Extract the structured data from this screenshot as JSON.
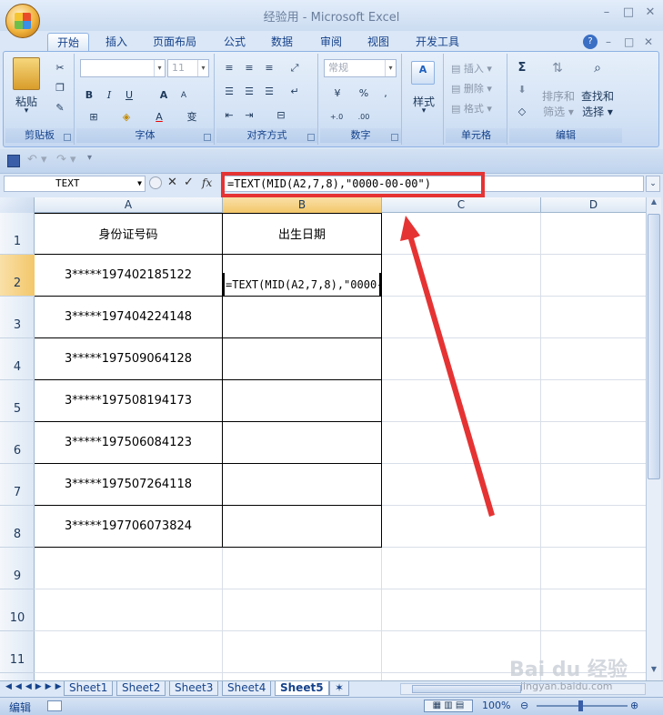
{
  "window": {
    "title": "经验用 - Microsoft Excel",
    "controls": {
      "minimize": "–",
      "maximize": "□",
      "close": "✕"
    }
  },
  "ribbon_tabs": [
    "开始",
    "插入",
    "页面布局",
    "公式",
    "数据",
    "审阅",
    "视图",
    "开发工具"
  ],
  "active_tab": "开始",
  "ribbon": {
    "clipboard": {
      "label": "剪贴板",
      "paste": "粘贴"
    },
    "font": {
      "label": "字体",
      "size": "11",
      "bold": "B",
      "italic": "I",
      "underline": "U"
    },
    "alignment": {
      "label": "对齐方式"
    },
    "number": {
      "label": "数字",
      "format": "常规",
      "percent": "%",
      "comma": ",",
      "inc_decimal": "+.0",
      "dec_decimal": ".00"
    },
    "styles": {
      "label": "样式"
    },
    "cells": {
      "label": "单元格",
      "insert": "插入",
      "delete": "删除",
      "format": "格式"
    },
    "editing": {
      "label": "编辑",
      "sort_filter_1": "排序和",
      "sort_filter_2": "筛选",
      "find_select_1": "查找和",
      "find_select_2": "选择"
    }
  },
  "formula_bar": {
    "name_box": "TEXT",
    "fx": "fx",
    "formula": "=TEXT(MID(A2,7,8),\"0000-00-00\")"
  },
  "columns": [
    "A",
    "B",
    "C",
    "D"
  ],
  "rows": [
    "1",
    "2",
    "3",
    "4",
    "5",
    "6",
    "7",
    "8",
    "9",
    "10",
    "11"
  ],
  "cells": {
    "A1": "身份证号码",
    "B1": "出生日期",
    "A2": "3*****197402185122",
    "B2": "=TEXT(MID(A2,7,8),\"0000-00-00\")",
    "A3": "3*****197404224148",
    "A4": "3*****197509064128",
    "A5": "3*****197508194173",
    "A6": "3*****197506084123",
    "A7": "3*****197507264118",
    "A8": "3*****197706073824"
  },
  "sheet_tabs": [
    "Sheet1",
    "Sheet2",
    "Sheet3",
    "Sheet4",
    "Sheet5"
  ],
  "active_sheet": "Sheet5",
  "status": {
    "mode": "编辑",
    "zoom": "100%"
  },
  "watermark": {
    "brand": "Bai du 经验",
    "url": "jingyan.baidu.com"
  },
  "colors": {
    "annotation": "#e53333",
    "ribbon": "#d3e2f5"
  }
}
